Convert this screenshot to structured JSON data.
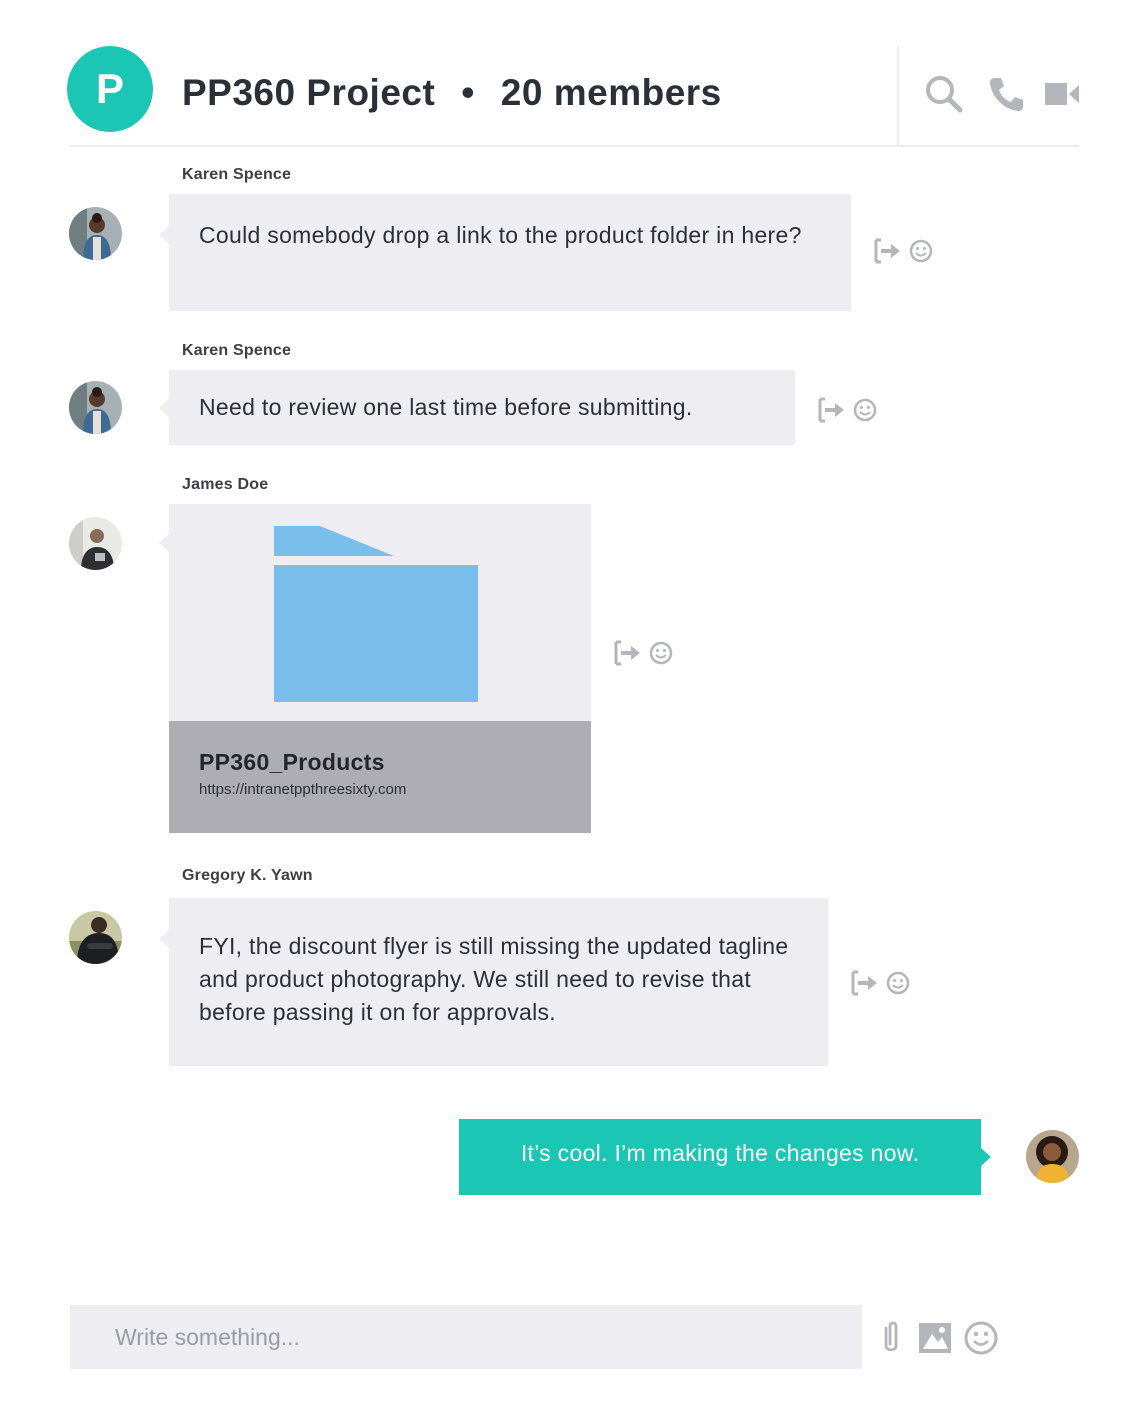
{
  "header": {
    "group_initial": "P",
    "group_name": "PP360 Project",
    "separator": "•",
    "members": "20 members",
    "icons": [
      "search-icon",
      "phone-icon",
      "video-camera-icon"
    ]
  },
  "messages": [
    {
      "sender": "Karen Spence",
      "text": "Could somebody drop a link to the product folder in here?"
    },
    {
      "sender": "Karen Spence",
      "text": "Need to review one last time before submitting."
    },
    {
      "sender": "James Doe",
      "file": {
        "name": "PP360_Products",
        "url": "https://intranetppthreesixty.com",
        "icon": "folder-icon"
      }
    },
    {
      "sender": "Gregory K. Yawn",
      "text": "FYI, the discount flyer is still missing the updated tagline and product photography. We still need to revise that before passing it on for approvals."
    }
  ],
  "own_message": {
    "text": "It’s cool. I’m making the changes now."
  },
  "message_actions": [
    "share-icon",
    "emoji-icon"
  ],
  "composer": {
    "placeholder": "Write something...",
    "icons": [
      "paperclip-icon",
      "image-icon",
      "emoji-icon"
    ]
  },
  "colors": {
    "accent": "#1cc6b4",
    "bubble": "#eeeef2",
    "file_meta": "#adadb3",
    "folder": "#7abfeb",
    "icon_gray": "#b4b6bb"
  }
}
